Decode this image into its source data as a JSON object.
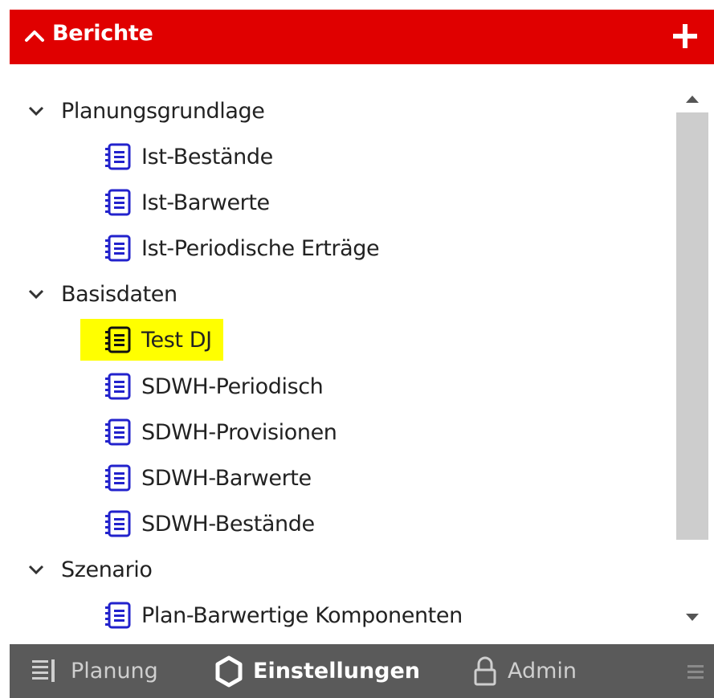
{
  "header": {
    "title": "Berichte"
  },
  "tree": [
    {
      "group": "Planungsgrundlage",
      "items": [
        "Ist-Bestände",
        "Ist-Barwerte",
        "Ist-Periodische Erträge"
      ]
    },
    {
      "group": "Basisdaten",
      "items": [
        "Test DJ",
        "SDWH-Periodisch",
        "SDWH-Provisionen",
        "SDWH-Barwerte",
        "SDWH-Bestände"
      ]
    },
    {
      "group": "Szenario",
      "items": [
        "Plan-Barwertige Komponenten"
      ]
    }
  ],
  "footer": {
    "planung": "Planung",
    "einstellungen": "Einstellungen",
    "admin": "Admin"
  },
  "colors": {
    "accent": "#e00000",
    "icon": "#2222cc",
    "highlight": "#ffff00",
    "footer_bg": "#5a5a5a"
  },
  "icons": {
    "collapse": "chevron-up-icon",
    "add": "plus-icon",
    "group": "chevron-down-icon",
    "report": "report-list-icon",
    "planung": "list-lines-icon",
    "einstellungen": "gear-icon",
    "admin": "lock-icon",
    "menu": "menu-icon"
  }
}
